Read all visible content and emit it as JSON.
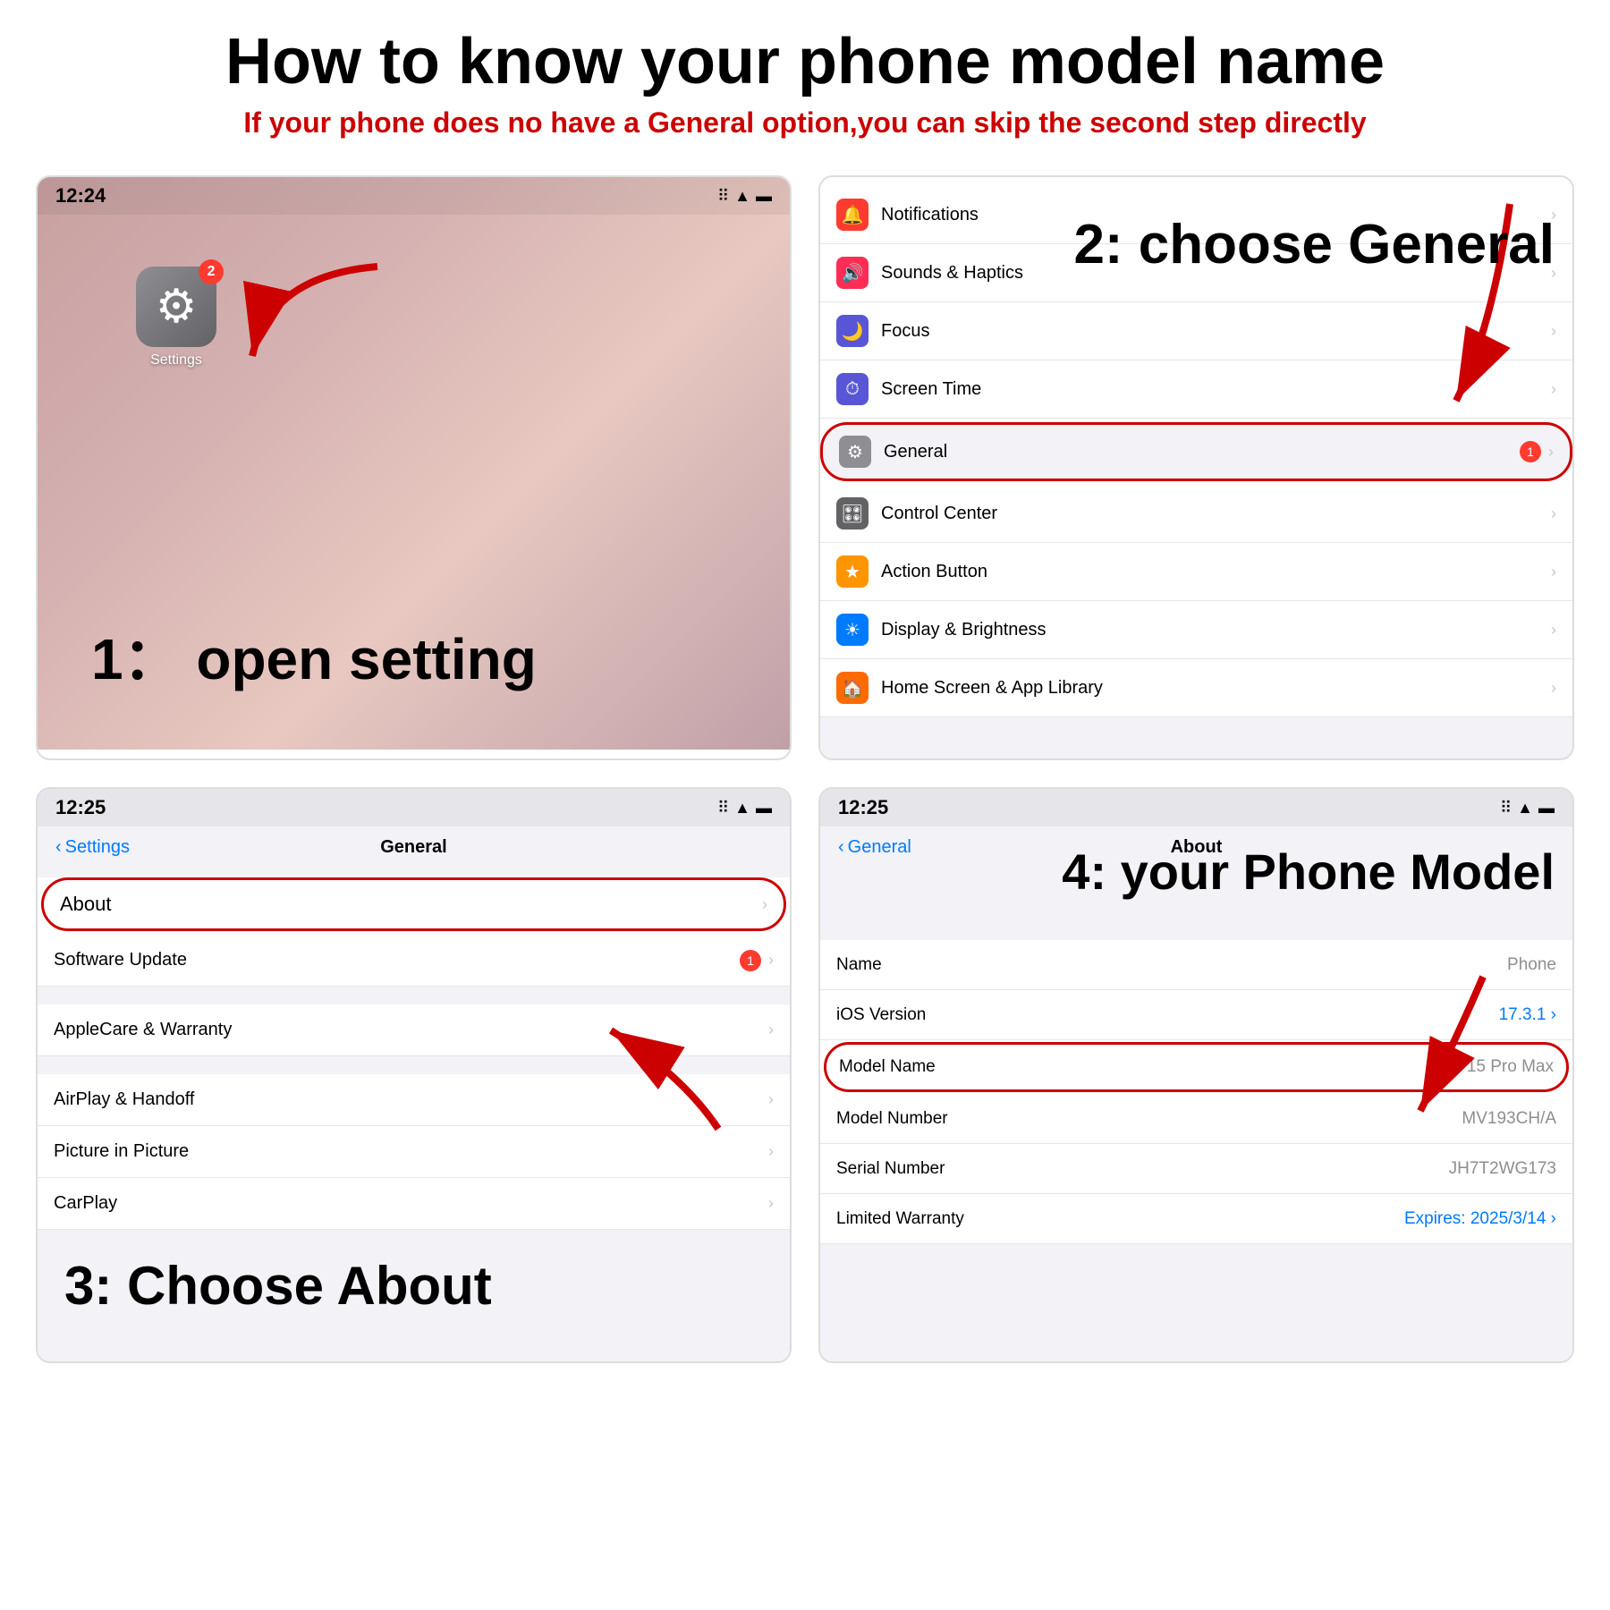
{
  "title": "How to know your phone model name",
  "subtitle": "If your phone does no have a General option,you can skip the second step directly",
  "step1": {
    "time": "12:24",
    "label": "1：  open setting",
    "badge": "2",
    "icon_label": "Settings"
  },
  "step2": {
    "label": "2: choose General",
    "items": [
      {
        "name": "Notifications",
        "icon_bg": "#ff3b30",
        "icon": "🔔"
      },
      {
        "name": "Sounds & Haptics",
        "icon_bg": "#ff2d55",
        "icon": "🔊"
      },
      {
        "name": "Focus",
        "icon_bg": "#5856d6",
        "icon": "🌙"
      },
      {
        "name": "Screen Time",
        "icon_bg": "#5856d6",
        "icon": "⏱"
      },
      {
        "name": "General",
        "icon_bg": "#8e8e93",
        "icon": "⚙",
        "badge": "1",
        "highlight": true
      },
      {
        "name": "Control Center",
        "icon_bg": "#636366",
        "icon": "🎛"
      },
      {
        "name": "Action Button",
        "icon_bg": "#ff9500",
        "icon": "★"
      },
      {
        "name": "Display & Brightness",
        "icon_bg": "#007aff",
        "icon": "☀"
      },
      {
        "name": "Home Screen & App Library",
        "icon_bg": "#ff6b00",
        "icon": "🏠"
      }
    ]
  },
  "step3": {
    "time": "12:25",
    "back_label": "Settings",
    "title": "General",
    "label": "3: Choose About",
    "items": [
      {
        "name": "About",
        "highlight": true
      },
      {
        "name": "Software Update",
        "badge": "1"
      },
      {
        "name": "",
        "divider": true
      },
      {
        "name": "AppleCare & Warranty"
      },
      {
        "name": "AirPlay & Handoff"
      },
      {
        "name": "Picture in Picture"
      },
      {
        "name": "CarPlay"
      }
    ]
  },
  "step4": {
    "time": "12:25",
    "back_label": "General",
    "title": "About",
    "label": "4:  your Phone Model",
    "items": [
      {
        "label": "Name",
        "value": "Phone",
        "gray": true
      },
      {
        "label": "iOS Version",
        "value": "17.3.1",
        "blue": true
      },
      {
        "label": "Model Name",
        "value": "15 Pro Max",
        "highlight": true
      },
      {
        "label": "Model Number",
        "value": "MV193CH/A"
      },
      {
        "label": "Serial Number",
        "value": "JH7T2WG173"
      },
      {
        "label": "Limited Warranty",
        "value": "Expires: 2025/3/14",
        "blue": true
      }
    ]
  }
}
